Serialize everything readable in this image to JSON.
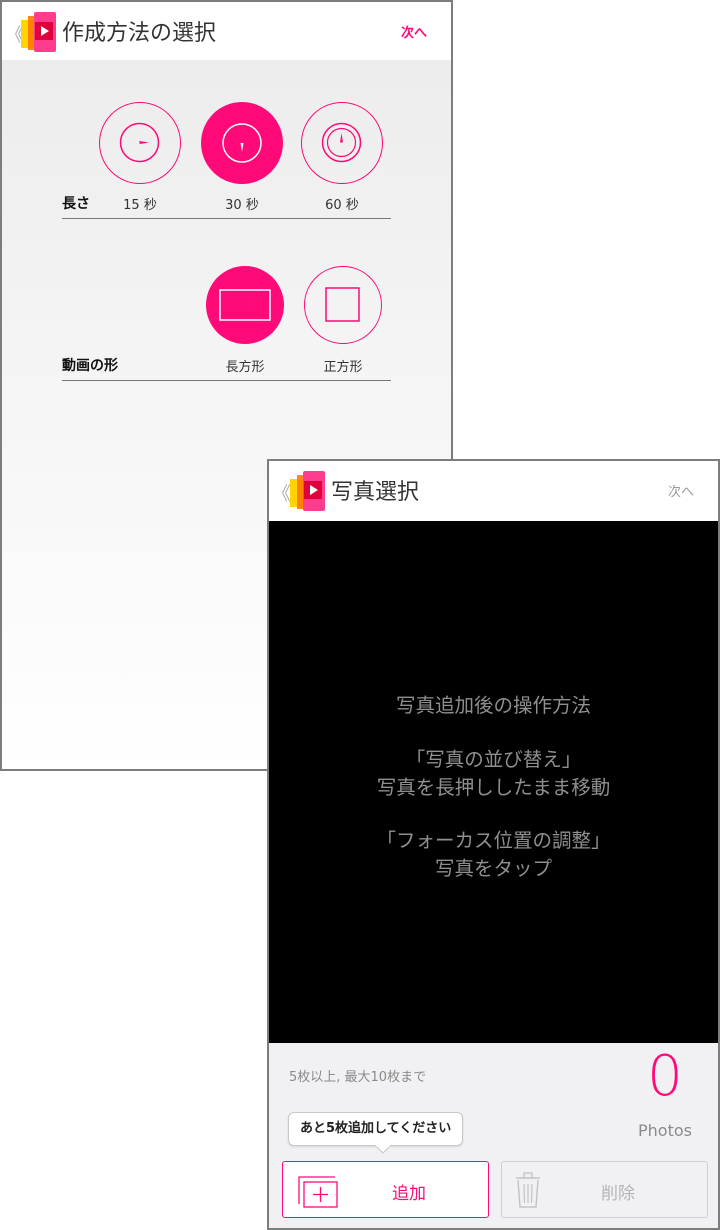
{
  "screen1": {
    "back_glyph": "《",
    "title": "作成方法の選択",
    "next_label": "次へ",
    "length": {
      "label": "長さ",
      "options": [
        {
          "label": "15 秒",
          "selected": false,
          "icon": "clock-15-icon"
        },
        {
          "label": "30 秒",
          "selected": true,
          "icon": "clock-30-icon"
        },
        {
          "label": "60 秒",
          "selected": false,
          "icon": "clock-60-icon"
        }
      ]
    },
    "shape": {
      "label": "動画の形",
      "options": [
        {
          "label": "長方形",
          "selected": true,
          "icon": "rectangle-icon"
        },
        {
          "label": "正方形",
          "selected": false,
          "icon": "square-icon"
        }
      ]
    }
  },
  "screen2": {
    "back_glyph": "《",
    "title": "写真選択",
    "next_label": "次へ",
    "guide": {
      "heading": "写真追加後の操作方法",
      "item1_title": "「写真の並び替え」",
      "item1_desc": "写真を長押ししたまま移動",
      "item2_title": "「フォーカス位置の調整」",
      "item2_desc": "写真をタップ"
    },
    "limit_text": "5枚以上, 最大10枚まで",
    "photo_count": "0",
    "photo_unit": "Photos",
    "tooltip": "あと5枚追加してください",
    "add_label": "追加",
    "delete_label": "削除"
  },
  "colors": {
    "accent": "#ff0a78",
    "disabled": "#b5b5b5",
    "logo_yellow": "#ffd400",
    "logo_orange": "#ff7a00",
    "logo_pink": "#ff3c8e"
  }
}
